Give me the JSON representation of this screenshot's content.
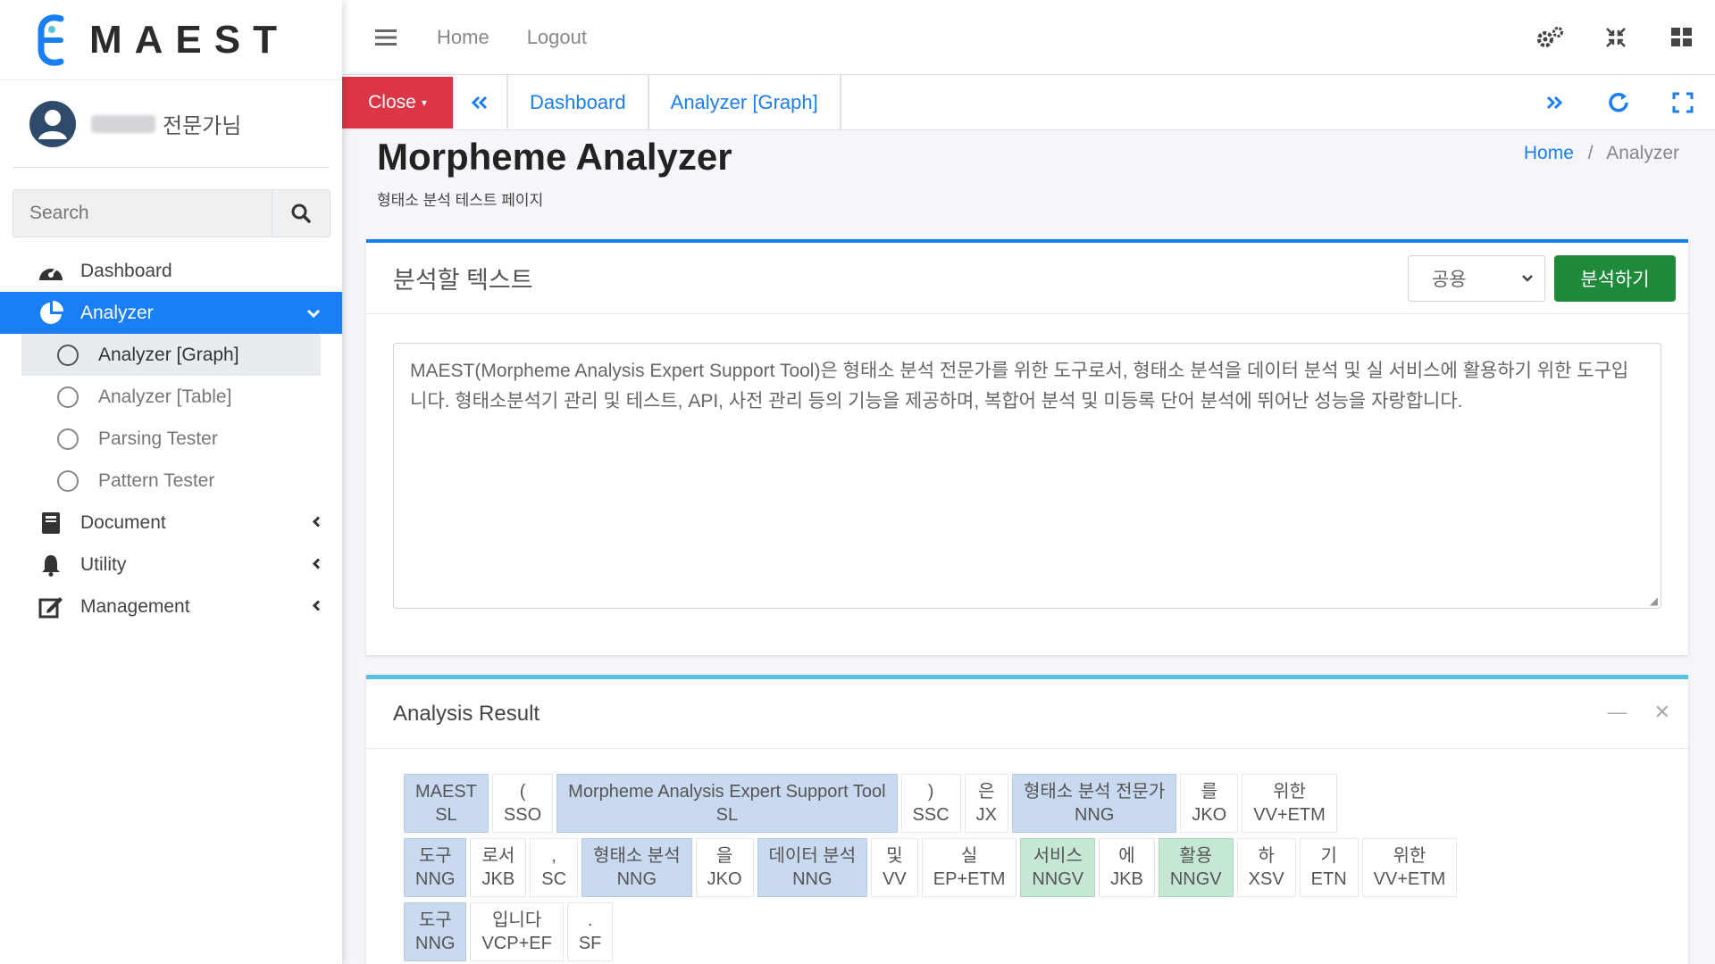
{
  "brand": {
    "name": "MAEST"
  },
  "user": {
    "role": "전문가님"
  },
  "sidebar": {
    "search_placeholder": "Search",
    "items": [
      {
        "label": "Dashboard",
        "icon": "dashboard-gauge-icon"
      },
      {
        "label": "Analyzer",
        "icon": "chart-pie-icon"
      },
      {
        "label": "Document",
        "icon": "book-icon"
      },
      {
        "label": "Utility",
        "icon": "bell-icon"
      },
      {
        "label": "Management",
        "icon": "edit-icon"
      }
    ],
    "subitems": [
      {
        "label": "Analyzer [Graph]"
      },
      {
        "label": "Analyzer [Table]"
      },
      {
        "label": "Parsing Tester"
      },
      {
        "label": "Pattern Tester"
      }
    ]
  },
  "topbar": {
    "home": "Home",
    "logout": "Logout"
  },
  "tabbar": {
    "close": "Close",
    "tabs": [
      {
        "label": "Dashboard"
      },
      {
        "label": "Analyzer [Graph]"
      }
    ]
  },
  "header": {
    "title": "Morpheme Analyzer",
    "subtitle": "형태소 분석 테스트 페이지",
    "breadcrumb": {
      "home": "Home",
      "current": "Analyzer"
    }
  },
  "input_card": {
    "title": "분석할 텍스트",
    "select_value": "공용",
    "analyze_button": "분석하기",
    "text": "MAEST(Morpheme Analysis Expert Support Tool)은 형태소 분석 전문가를 위한 도구로서, 형태소 분석을 데이터 분석 및 실 서비스에 활용하기 위한 도구입니다. 형태소분석기 관리 및 테스트, API, 사전 관리 등의 기능을 제공하며, 복합어 분석 및 미등록 단어 분석에 뛰어난 성능을 자랑합니다."
  },
  "result_card": {
    "title": "Analysis Result",
    "rows": [
      [
        {
          "w": "MAEST",
          "t": "SL",
          "k": "noun"
        },
        {
          "w": "(",
          "t": "SSO",
          "k": "plain"
        },
        {
          "w": "Morpheme Analysis Expert Support Tool",
          "t": "SL",
          "k": "noun"
        },
        {
          "w": ")",
          "t": "SSC",
          "k": "plain"
        },
        {
          "w": "은",
          "t": "JX",
          "k": "plain"
        },
        {
          "w": "형태소 분석 전문가",
          "t": "NNG",
          "k": "noun"
        },
        {
          "w": "를",
          "t": "JKO",
          "k": "plain"
        },
        {
          "w": "위한",
          "t": "VV+ETM",
          "k": "plain"
        }
      ],
      [
        {
          "w": "도구",
          "t": "NNG",
          "k": "noun"
        },
        {
          "w": "로서",
          "t": "JKB",
          "k": "plain"
        },
        {
          "w": ",",
          "t": "SC",
          "k": "plain"
        },
        {
          "w": "형태소 분석",
          "t": "NNG",
          "k": "noun"
        },
        {
          "w": "을",
          "t": "JKO",
          "k": "plain"
        },
        {
          "w": "데이터 분석",
          "t": "NNG",
          "k": "noun"
        },
        {
          "w": "및",
          "t": "VV",
          "k": "plain"
        },
        {
          "w": "실",
          "t": "EP+ETM",
          "k": "plain"
        },
        {
          "w": "서비스",
          "t": "NNGV",
          "k": "verbnoun"
        },
        {
          "w": "에",
          "t": "JKB",
          "k": "plain"
        },
        {
          "w": "활용",
          "t": "NNGV",
          "k": "verbnoun"
        },
        {
          "w": "하",
          "t": "XSV",
          "k": "plain"
        },
        {
          "w": "기",
          "t": "ETN",
          "k": "plain"
        },
        {
          "w": "위한",
          "t": "VV+ETM",
          "k": "plain"
        }
      ],
      [
        {
          "w": "도구",
          "t": "NNG",
          "k": "noun"
        },
        {
          "w": "입니다",
          "t": "VCP+EF",
          "k": "plain"
        },
        {
          "w": ".",
          "t": "SF",
          "k": "plain"
        }
      ]
    ]
  },
  "colors": {
    "primary": "#1a7ef5",
    "danger": "#dc3545",
    "success": "#1e8a3a",
    "info": "#5bc0de",
    "noun_chip": "#c9daf0",
    "verbnoun_chip": "#c5e7d3"
  }
}
